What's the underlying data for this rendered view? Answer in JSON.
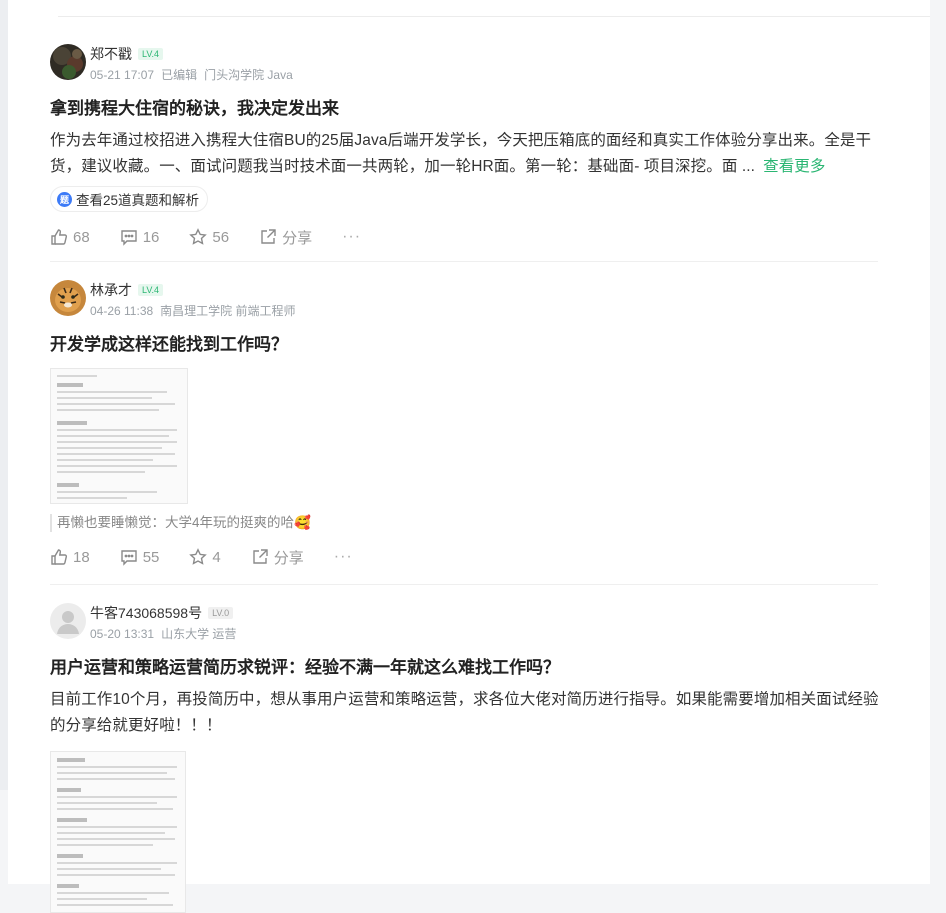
{
  "posts": [
    {
      "user": "郑不戳",
      "level": "LV.4",
      "date": "05-21 17:07",
      "edited": "已编辑",
      "affiliation": "门头沟学院 Java",
      "title": "拿到携程大住宿的秘诀，我决定发出来",
      "excerpt": "作为去年通过校招进入携程大住宿BU的25届Java后端开发学长，今天把压箱底的面经和真实工作体验分享出来。全是干货，建议收藏。一、面试问题我当时技术面一共两轮，加一轮HR面。第一轮：基础面- 项目深挖。面 ...",
      "more_link": "查看更多",
      "pill_icon": "题",
      "pill_label": "查看25道真题和解析",
      "likes": "68",
      "comments": "16",
      "stars": "56",
      "share": "分享",
      "more_dots": "···"
    },
    {
      "user": "林承才",
      "level": "LV.4",
      "date": "04-26 11:38",
      "affiliation": "南昌理工学院 前端工程师",
      "title": "开发学成这样还能找到工作吗？",
      "quote": "再懒也要睡懒觉：大学4年玩的挺爽的哈🥰",
      "likes": "18",
      "comments": "55",
      "stars": "4",
      "share": "分享",
      "more_dots": "···"
    },
    {
      "user": "牛客743068598号",
      "level": "LV.0",
      "date": "05-20 13:31",
      "affiliation": "山东大学 运营",
      "title": "用户运营和策略运营简历求锐评：经验不满一年就这么难找工作吗？",
      "excerpt": "目前工作10个月，再投简历中，想从事用户运营和策略运营，求各位大佬对简历进行指导。如果能需要增加相关面试经验的分享给就更好啦！！！"
    }
  ],
  "colors": {
    "accent": "#2bb673",
    "text_primary": "#222222",
    "text_meta": "#9aa0a6",
    "page_bg": "#f4f5f7"
  },
  "icons": [
    "like-icon",
    "comment-icon",
    "star-icon",
    "share-icon",
    "more-icon",
    "question-bank-icon"
  ]
}
